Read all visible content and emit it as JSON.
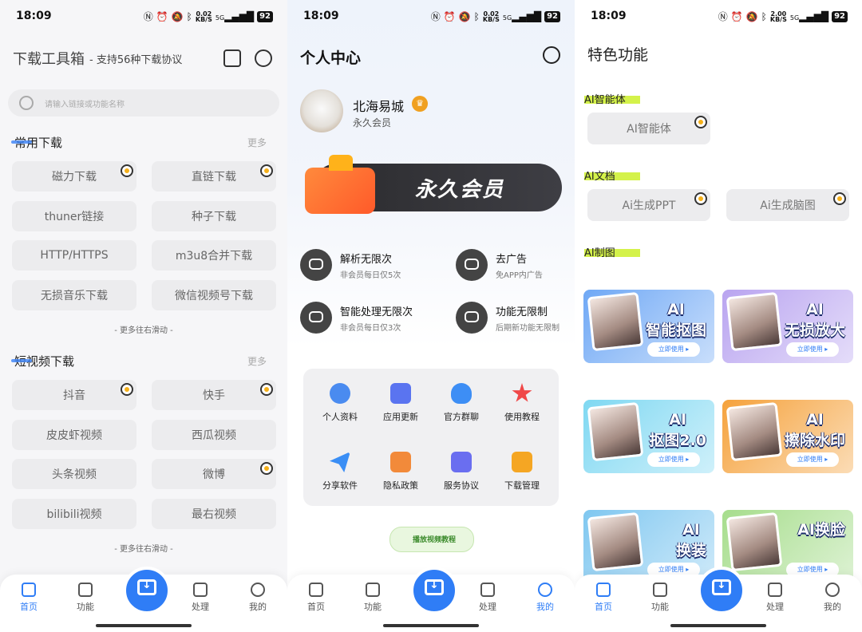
{
  "status": [
    {
      "time": "18:09",
      "speed": "0.02",
      "unit": "KB/S",
      "net": "5G",
      "battery": "92"
    },
    {
      "time": "18:09",
      "speed": "0.02",
      "unit": "KB/S",
      "net": "5G",
      "battery": "92"
    },
    {
      "time": "18:09",
      "speed": "2.00",
      "unit": "KB/S",
      "net": "5G",
      "battery": "92"
    }
  ],
  "home": {
    "title": "下载工具箱",
    "subtitle": "- 支持56种下载协议",
    "search_placeholder": "请输入链接或功能名称",
    "common_title": "常用下载",
    "more": "更多",
    "common_items": [
      "磁力下载",
      "直链下载",
      "thuner链接",
      "种子下载",
      "HTTP/HTTPS",
      "m3u8合并下载",
      "无损音乐下载",
      "微信视频号下载"
    ],
    "scroll_hint": "- 更多往右滑动 -",
    "video_title": "短视频下载",
    "video_items": [
      "抖音",
      "快手",
      "皮皮虾视频",
      "西瓜视频",
      "头条视频",
      "微博",
      "bilibili视频",
      "最右视频"
    ]
  },
  "profile": {
    "title": "个人中心",
    "username": "北海易城",
    "member": "永久会员",
    "banner_text": "永久会员",
    "perks": [
      {
        "title": "解析无限次",
        "sub": "非会员每日仅5次"
      },
      {
        "title": "去广告",
        "sub": "免APP内广告"
      },
      {
        "title": "智能处理无限次",
        "sub": "非会员每日仅3次"
      },
      {
        "title": "功能无限制",
        "sub": "后期新功能无限制"
      }
    ],
    "grid": [
      "个人资料",
      "应用更新",
      "官方群聊",
      "使用教程",
      "分享软件",
      "隐私政策",
      "服务协议",
      "下载管理"
    ],
    "tutorial": "播放视频教程"
  },
  "features": {
    "title": "特色功能",
    "sections": [
      {
        "title": "AI智能体",
        "items": [
          "AI智能体"
        ]
      },
      {
        "title": "AI文档",
        "items": [
          "Ai生成PPT",
          "Ai生成脑图"
        ]
      },
      {
        "title": "AI制图",
        "items": []
      }
    ],
    "cards": [
      {
        "line1": "AI",
        "line2": "智能抠图",
        "btn": "立即使用 ▸",
        "color": "#6fa8f5"
      },
      {
        "line1": "AI",
        "line2": "无损放大",
        "btn": "立即使用 ▸",
        "color": "#b9a4f0"
      },
      {
        "line1": "AI",
        "line2": "抠图2.0",
        "btn": "立即使用 ▸",
        "color": "#7fd8f2"
      },
      {
        "line1": "AI",
        "line2": "擦除水印",
        "btn": "立即使用 ▸",
        "color": "#f5a23c"
      },
      {
        "line1": "AI",
        "line2": "换装",
        "btn": "立即使用 ▸",
        "color": "#7fc7f0"
      },
      {
        "line1": "AI换脸",
        "line2": "",
        "btn": "立即使用 ▸",
        "color": "#a6dd8c"
      }
    ]
  },
  "nav": [
    "首页",
    "功能",
    "处理",
    "我的"
  ]
}
